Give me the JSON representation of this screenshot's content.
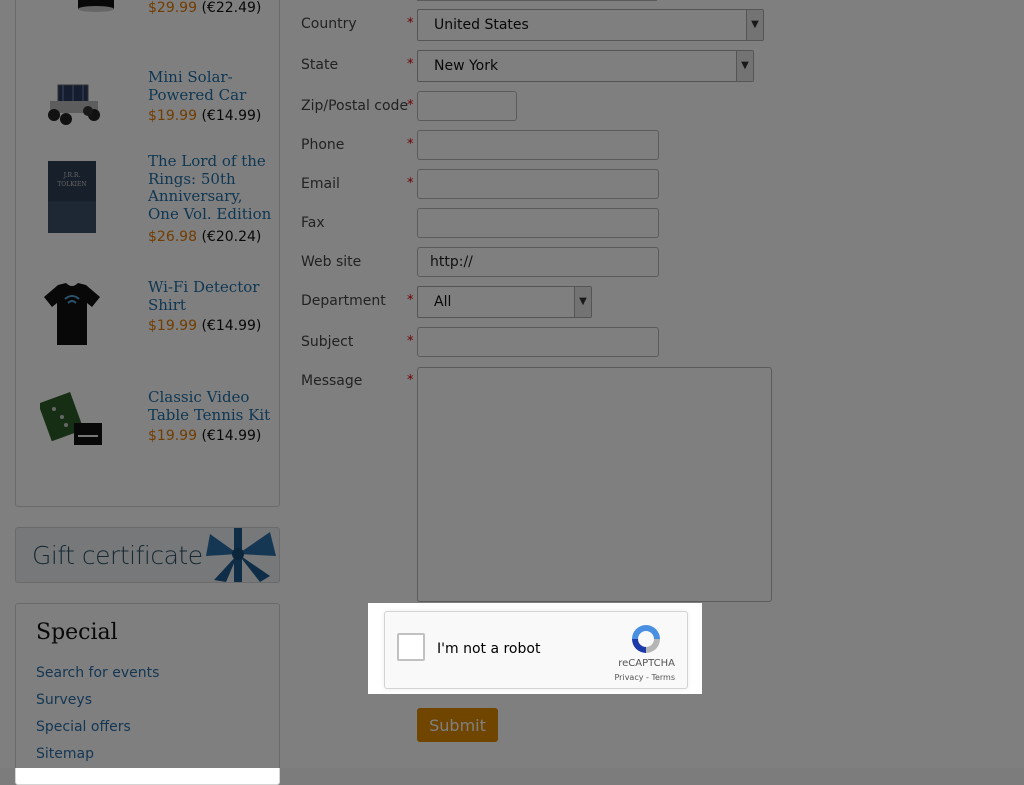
{
  "sidebar": {
    "products": [
      {
        "name": "",
        "price": "$29.99",
        "alt_price": "(€22.49)"
      },
      {
        "name": "Mini Solar-Powered Car",
        "price": "$19.99",
        "alt_price": "(€14.99)"
      },
      {
        "name": "The Lord of the Rings: 50th Anniversary, One Vol. Edition",
        "price": "$26.98",
        "alt_price": "(€20.24)"
      },
      {
        "name": "Wi-Fi Detector Shirt",
        "price": "$19.99",
        "alt_price": "(€14.99)"
      },
      {
        "name": "Classic Video Table Tennis Kit",
        "price": "$19.99",
        "alt_price": "(€14.99)"
      }
    ],
    "gift_certificate": "Gift certificate",
    "special": {
      "title": "Special",
      "links": [
        "Search for events",
        "Surveys",
        "Special offers",
        "Sitemap"
      ]
    }
  },
  "form": {
    "country": {
      "label": "Country",
      "value": "United States"
    },
    "state": {
      "label": "State",
      "value": "New York"
    },
    "zip": {
      "label": "Zip/Postal code",
      "value": ""
    },
    "phone": {
      "label": "Phone",
      "value": ""
    },
    "email": {
      "label": "Email",
      "value": ""
    },
    "fax": {
      "label": "Fax",
      "value": ""
    },
    "website": {
      "label": "Web site",
      "value": "http://"
    },
    "department": {
      "label": "Department",
      "value": "All"
    },
    "subject": {
      "label": "Subject",
      "value": ""
    },
    "message": {
      "label": "Message",
      "value": ""
    },
    "required_mark": "*",
    "submit_label": "Submit"
  },
  "captcha": {
    "label": "I'm not a robot",
    "brand": "reCAPTCHA",
    "links": "Privacy - Terms"
  },
  "colors": {
    "link": "#1f6fa6",
    "sale_price": "#e47a00",
    "submit_bg": "#e08b00",
    "required": "#dd0000"
  }
}
